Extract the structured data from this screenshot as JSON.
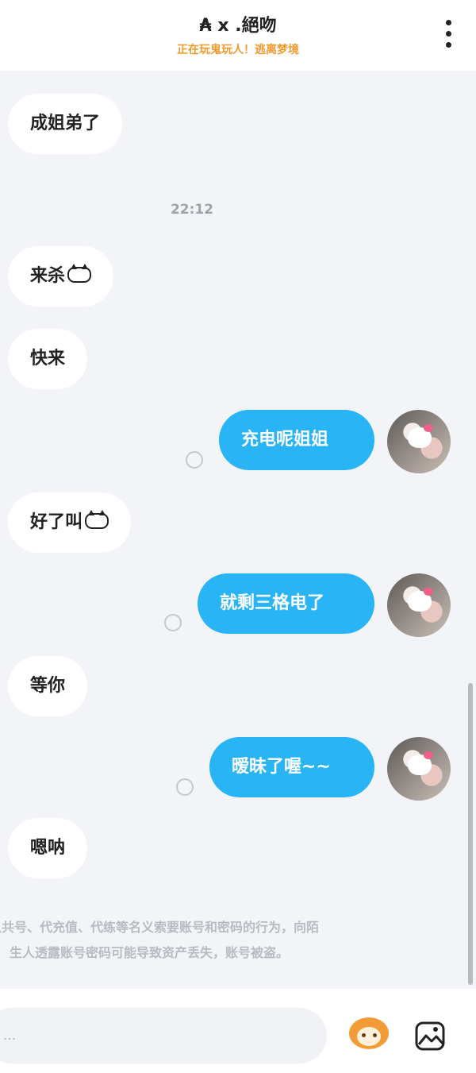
{
  "header": {
    "title": "₳ x .絕吻",
    "subtitle": "正在玩鬼玩人！逃离梦境"
  },
  "chat": {
    "time": "22:12",
    "messages": [
      {
        "text": "成姐弟了"
      },
      {
        "text": "来杀"
      },
      {
        "text": "快来"
      },
      {
        "text": "充电呢姐姐"
      },
      {
        "text": "好了叫"
      },
      {
        "text": "就剩三格电了"
      },
      {
        "text": "等你"
      },
      {
        "text": "暧昧了喔~~"
      },
      {
        "text": "嗯呐"
      }
    ]
  },
  "notice": {
    "line1": "以共号、代充值、代练等名义索要账号和密码的行为，向陌",
    "line2": "生人透露账号密码可能导致资产丢失，账号被盗。"
  },
  "footer": {
    "input_placeholder": "..."
  },
  "colors": {
    "outgoing_bubble": "#29b4f6",
    "subtitle": "#f19a2b"
  }
}
